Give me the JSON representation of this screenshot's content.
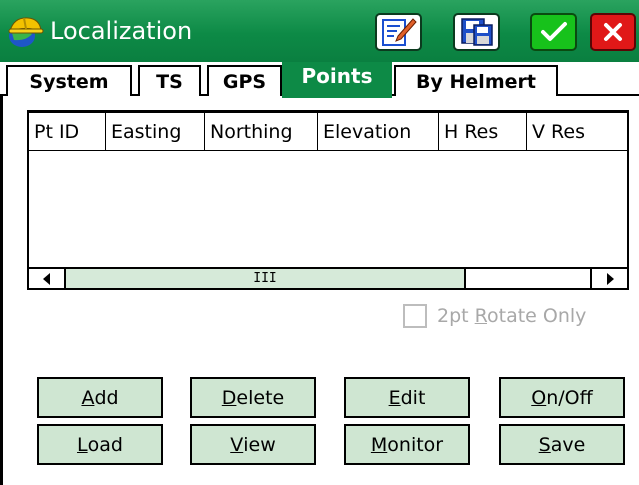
{
  "window": {
    "title": "Localization",
    "title_icon": "helmet-globe-icon",
    "toolbar_icons": [
      "edit-document-icon",
      "save-disk-icon",
      "checkmark-icon",
      "close-x-icon"
    ],
    "colors": {
      "title_bar": "#0d8a46",
      "ok": "#17c21b",
      "close": "#e01818",
      "button_face": "#cfe6d2",
      "active_tab": "#0d8a46"
    }
  },
  "tabs": [
    {
      "label": "System",
      "active": false
    },
    {
      "label": "TS",
      "active": false
    },
    {
      "label": "GPS",
      "active": false
    },
    {
      "label": "Points",
      "active": true
    },
    {
      "label": "By Helmert",
      "active": false
    }
  ],
  "table": {
    "columns": [
      "Pt ID",
      "Easting",
      "Northing",
      "Elevation",
      "H Res",
      "V Res"
    ],
    "rows": [],
    "scroll_thumb_label": "III",
    "scroll_position": 0
  },
  "rotate_option": {
    "label_before": "2pt ",
    "label_mnemonic": "R",
    "label_after": "otate Only",
    "checked": false,
    "enabled": false
  },
  "buttons": {
    "add": {
      "mn": "A",
      "rest": "dd"
    },
    "delete": {
      "mn": "D",
      "rest": "elete"
    },
    "edit": {
      "mn": "E",
      "rest": "dit"
    },
    "onoff": {
      "mn": "O",
      "rest": "n/Off"
    },
    "load": {
      "mn": "L",
      "rest": "oad"
    },
    "view": {
      "mn": "V",
      "rest": "iew"
    },
    "monitor": {
      "mn": "M",
      "rest": "onitor"
    },
    "save": {
      "mn": "S",
      "rest": "ave"
    }
  }
}
